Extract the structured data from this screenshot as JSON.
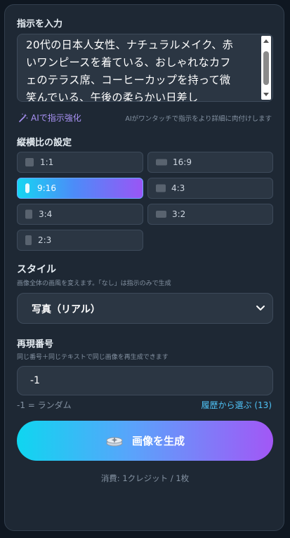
{
  "prompt": {
    "title": "指示を入力",
    "lines": [
      "20代の日本人女性、ナチュラルメイク、赤",
      "いワンピースを着ている、おしゃれなカフ",
      "ェのテラス席、コーヒーカップを持って微",
      "笑んでいる、午後の柔らかい日差し"
    ],
    "enhance_label": "AIで指示強化",
    "enhance_hint": "AIがワンタッチで指示をより詳細に肉付けします"
  },
  "aspect": {
    "title": "縦横比の設定",
    "options": [
      {
        "label": "1:1"
      },
      {
        "label": "16:9"
      },
      {
        "label": "9:16"
      },
      {
        "label": "4:3"
      },
      {
        "label": "3:4"
      },
      {
        "label": "3:2"
      },
      {
        "label": "2:3"
      }
    ],
    "selected": "9:16"
  },
  "style": {
    "title": "スタイル",
    "subtitle": "画像全体の画風を変えます。「なし」は指示のみで生成",
    "selected": "写真（リアル）"
  },
  "seed": {
    "title": "再現番号",
    "subtitle": "同じ番号＋同じテキストで同じ画像を再生成できます",
    "value": "-1",
    "random_hint": "-1 = ランダム",
    "history_link": "履歴から選ぶ (13)"
  },
  "generate": {
    "label": "画像を生成"
  },
  "cost": "消費: 1クレジット / 1枚",
  "colors": {
    "accent_cyan": "#16d6f2",
    "accent_purple": "#9a55f5",
    "link": "#4fc3f7",
    "enhance": "#a992f5"
  }
}
